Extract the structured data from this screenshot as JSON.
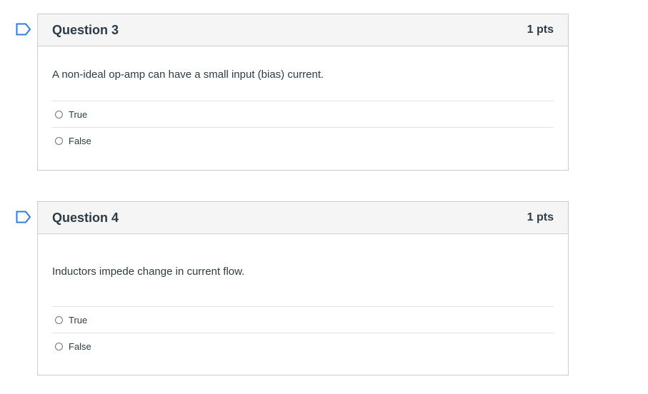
{
  "questions": [
    {
      "title": "Question 3",
      "points": "1 pts",
      "text": "A non-ideal op-amp can have a small input (bias) current.",
      "answers": [
        "True",
        "False"
      ]
    },
    {
      "title": "Question 4",
      "points": "1 pts",
      "text": "Inductors impede change in current flow.",
      "answers": [
        "True",
        "False"
      ]
    }
  ],
  "colors": {
    "flag": "#2d7de0",
    "header_bg": "#f5f5f5",
    "border": "#c7cdd1",
    "text": "#2d3b45"
  },
  "icons": {
    "flag": "flag-question-icon",
    "radio": "radio-unchecked-icon"
  }
}
